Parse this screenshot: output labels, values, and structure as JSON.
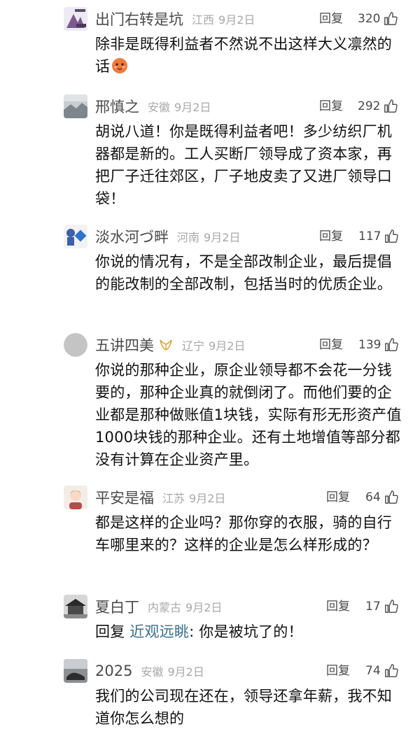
{
  "comments": [
    {
      "name": "出门右转是坑",
      "location": "江西",
      "date": "9月2日",
      "reply": "回复",
      "likes": "320",
      "text": "除非是既得利益者不然说不出这样大义凛然的话"
    },
    {
      "name": "邢慎之",
      "location": "安徽",
      "date": "9月2日",
      "reply": "回复",
      "likes": "292",
      "text": "胡说八道！你是既得利益者吧！多少纺织厂机器都是新的。工人买断厂领导成了资本家，再把厂子迁往郊区，厂子地皮卖了又进厂领导口袋！"
    },
    {
      "name": "淡水河づ畔",
      "location": "河南",
      "date": "9月2日",
      "reply": "回复",
      "likes": "117",
      "text": "你说的情况有，不是全部改制企业，最后提倡的能改制的全部改制，包括当时的优质企业。"
    },
    {
      "name": "五讲四美",
      "location": "辽宁",
      "date": "9月2日",
      "reply": "回复",
      "likes": "139",
      "text": "你说的那种企业，原企业领导都不会花一分钱要的，那种企业真的就倒闭了。而他们要的企业都是那种做账值1块钱，实际有形无形资产值1000块钱的那种企业。还有土地增值等部分都没有计算在企业资产里。"
    },
    {
      "name": "平安是福",
      "location": "江苏",
      "date": "9月2日",
      "reply": "回复",
      "likes": "64",
      "text": "都是这样的企业吗？那你穿的衣服，骑的自行车哪里来的？这样的企业是怎么样形成的？"
    },
    {
      "name": "夏白丁",
      "location": "内蒙古",
      "date": "9月2日",
      "reply": "回复",
      "likes": "17",
      "reply_prefix": "回复",
      "reply_to": "近观远眺",
      "reply_sep": ":",
      "text": " 你是被坑了的！"
    },
    {
      "name": "2025",
      "location": "安徽",
      "date": "9月2日",
      "reply": "回复",
      "likes": "74",
      "text": "我们的公司现在还在，领导还拿年薪，我不知道你怎么想的"
    }
  ],
  "icons": {
    "like": "thumbs-up-icon",
    "emoji": "blushing-face-emoji",
    "badge": "vip-wings-icon"
  },
  "colors": {
    "text": "#111111",
    "meta": "#4a4a4a",
    "muted": "#a8a8a8",
    "link": "#3a6e8c"
  }
}
